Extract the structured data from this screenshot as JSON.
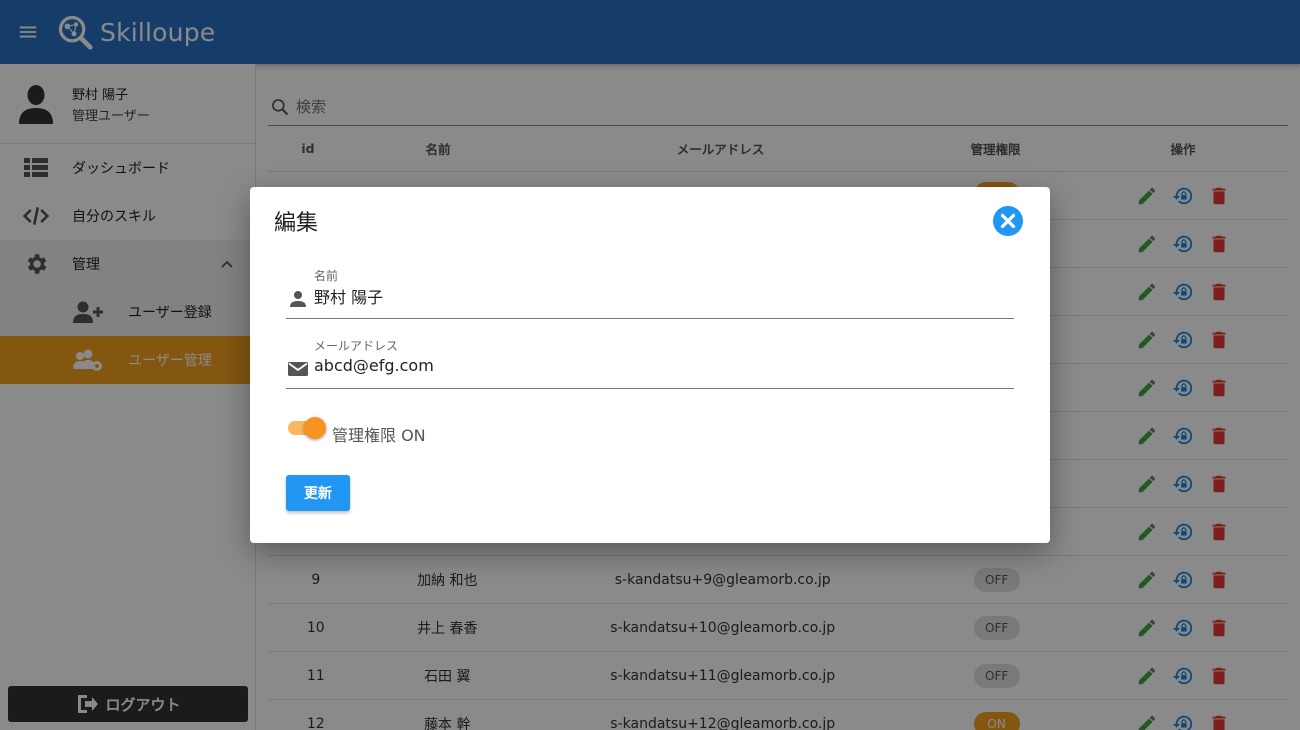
{
  "header": {
    "title": "Skilloupe",
    "menu_icon": "menu-icon",
    "logo_icon": "magnifier-network-logo"
  },
  "sidebar": {
    "user_name": "野村 陽子",
    "user_role": "管理ユーザー",
    "items": [
      {
        "label": "ダッシュボード",
        "icon": "dashboard-list-icon"
      },
      {
        "label": "自分のスキル",
        "icon": "code-icon"
      },
      {
        "label": "管理",
        "icon": "gear-icon"
      },
      {
        "label": "ユーザー登録",
        "icon": "add-user-icon"
      },
      {
        "label": "ユーザー管理",
        "icon": "users-gear-icon"
      }
    ],
    "logout_label": "ログアウト"
  },
  "search": {
    "placeholder": "検索"
  },
  "table": {
    "headers": [
      "id",
      "名前",
      "メールアドレス",
      "管理権限",
      "操作"
    ],
    "rows": [
      {
        "id": "9",
        "name": "加納 和也",
        "email": "s-kandatsu+9@gleamorb.co.jp",
        "admin": "OFF"
      },
      {
        "id": "10",
        "name": "井上 春香",
        "email": "s-kandatsu+10@gleamorb.co.jp",
        "admin": "OFF"
      },
      {
        "id": "11",
        "name": "石田 翼",
        "email": "s-kandatsu+11@gleamorb.co.jp",
        "admin": "OFF"
      },
      {
        "id": "12",
        "name": "藤本 幹",
        "email": "s-kandatsu+12@gleamorb.co.jp",
        "admin": "ON"
      }
    ]
  },
  "dialog": {
    "title": "編集",
    "name_label": "名前",
    "name_value": "野村 陽子",
    "email_label": "メールアドレス",
    "email_value": "abcd@efg.com",
    "admin_toggle_label": "管理権限 ON",
    "admin_on": true,
    "update_label": "更新"
  },
  "colors": {
    "primary": "#2a72c4",
    "accent": "#f4a11f",
    "button": "#2196f3",
    "edit": "#43a047",
    "reset": "#1e88e5",
    "delete": "#e53935"
  }
}
